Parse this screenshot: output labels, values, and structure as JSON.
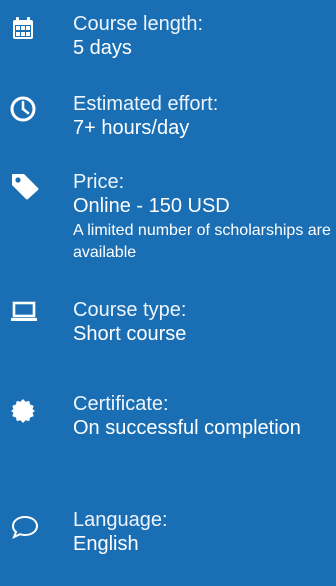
{
  "colors": {
    "background": "#1a6fb4",
    "text": "#ffffff"
  },
  "course_info": {
    "length": {
      "icon": "calendar-icon",
      "label": "Course length:",
      "value": "5 days"
    },
    "effort": {
      "icon": "clock-icon",
      "label": "Estimated effort:",
      "value": "7+ hours/day"
    },
    "price": {
      "icon": "price-tag-icon",
      "label": "Price:",
      "value": "Online - 150 USD",
      "note": "A limited number of scholarships are available"
    },
    "type": {
      "icon": "laptop-icon",
      "label": "Course type:",
      "value": "Short course"
    },
    "certificate": {
      "icon": "certificate-badge-icon",
      "label": "Certificate:",
      "value": "On successful completion"
    },
    "language": {
      "icon": "speech-bubble-icon",
      "label": "Language:",
      "value": "English"
    }
  }
}
